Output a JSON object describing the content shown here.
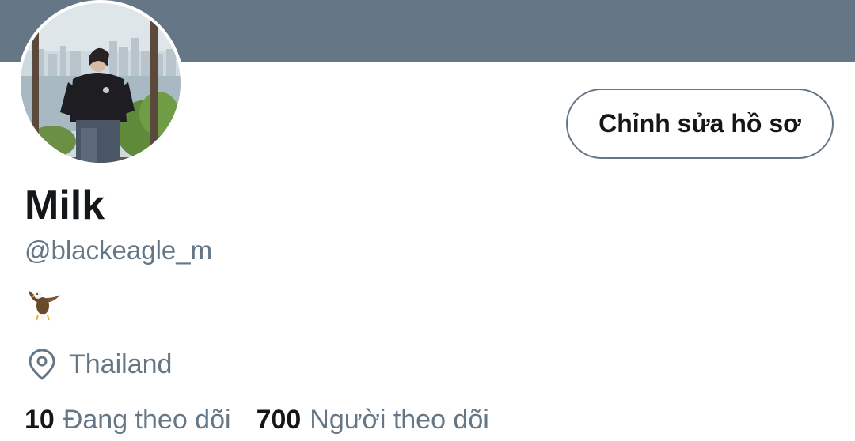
{
  "profile": {
    "banner_color": "#657786",
    "avatar": "profile-photo",
    "display_name": "Milk",
    "handle": "@blackeagle_m",
    "bio_emoji": "eagle-icon",
    "location": "Thailand",
    "location_icon": "location-pin-icon"
  },
  "actions": {
    "edit_profile_label": "Chỉnh sửa hồ sơ"
  },
  "stats": {
    "following_count": "10",
    "following_label": "Đang theo dõi",
    "followers_count": "700",
    "followers_label": "Người theo dõi"
  },
  "colors": {
    "primary_text": "#14171a",
    "secondary_text": "#657786",
    "border": "#657786"
  }
}
